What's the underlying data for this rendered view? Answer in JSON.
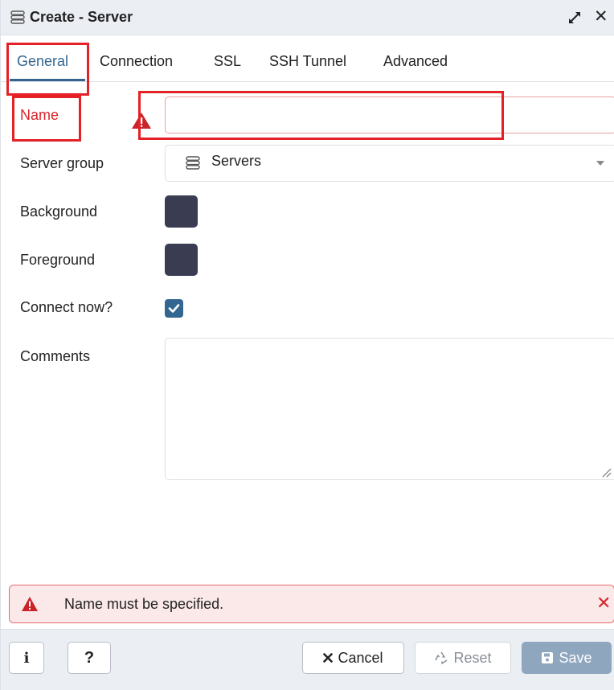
{
  "window": {
    "title": "Create - Server",
    "title_icon": "server-icon",
    "expand_icon": "expand-icon",
    "close_symbol": "✕"
  },
  "tabs": [
    {
      "label": "General",
      "active": true
    },
    {
      "label": "Connection",
      "active": false
    },
    {
      "label": "SSL",
      "active": false
    },
    {
      "label": "SSH Tunnel",
      "active": false
    },
    {
      "label": "Advanced",
      "active": false
    }
  ],
  "form": {
    "name": {
      "label": "Name",
      "value": "",
      "has_error": true
    },
    "server_group": {
      "label": "Server group",
      "value": "Servers"
    },
    "background": {
      "label": "Background",
      "color": "#3a3d52"
    },
    "foreground": {
      "label": "Foreground",
      "color": "#3a3d52"
    },
    "connect_now": {
      "label": "Connect now?",
      "checked": true
    },
    "comments": {
      "label": "Comments",
      "value": ""
    }
  },
  "error_bar": {
    "message": "Name must be specified.",
    "close_symbol": "✕"
  },
  "footer": {
    "info_label": "i",
    "help_label": "?",
    "cancel_label": "Cancel",
    "reset_label": "Reset",
    "save_label": "Save"
  },
  "colors": {
    "accent": "#326690",
    "error": "#d9242b",
    "error_bg": "#fbe9e9",
    "highlight": "#e32127",
    "save_disabled": "#8fa6bf"
  }
}
